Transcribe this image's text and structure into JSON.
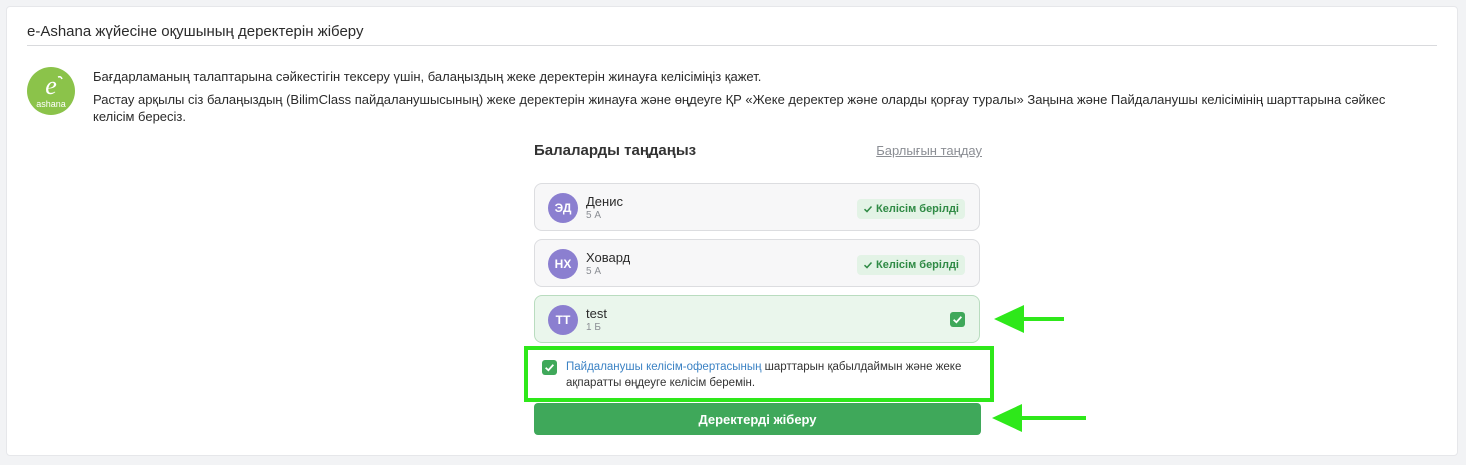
{
  "panel": {
    "title": "e-Ashana жүйесіне оқушының деректерін жіберу",
    "logo_text": "ashana"
  },
  "intro": {
    "line1": "Бағдарламаның талаптарына сәйкестігін тексеру үшін, балаңыздың жеке деректерін жинауға келісіміңіз қажет.",
    "line2": "Растау арқылы сіз балаңыздың (BilimClass пайдаланушысының) жеке деректерін жинауға және өңдеуге ҚР «Жеке деректер және оларды қорғау туралы» Заңына және Пайдаланушы келісімінің шарттарына сәйкес келісім бересіз."
  },
  "children_section": {
    "title": "Балаларды таңдаңыз",
    "select_all": "Барлығын таңдау"
  },
  "children": [
    {
      "initials": "ЭД",
      "name": "Денис",
      "class": "5 А",
      "status": "Келісім берілді",
      "selected": false
    },
    {
      "initials": "НХ",
      "name": "Ховард",
      "class": "5 А",
      "status": "Келісім берілді",
      "selected": false
    },
    {
      "initials": "ТТ",
      "name": "test",
      "class": "1 Б",
      "status": "",
      "selected": true
    }
  ],
  "agreement": {
    "link_text": "Пайдаланушы келісім-офертасының",
    "rest_text": " шарттарын қабылдаймын және жеке ақпаратты өңдеуге келісім беремін.",
    "checked": true
  },
  "submit": {
    "label": "Деректерді жіберу"
  },
  "colors": {
    "accent_green": "#3fa85a",
    "highlight_green": "#2ee81a",
    "avatar_purple": "#8b7fd0",
    "link_blue": "#3b82c4",
    "logo_green": "#8bc34a"
  },
  "icons": {
    "logo": "e-ashana-logo",
    "check": "check-icon",
    "arrow": "arrow-left-icon"
  }
}
